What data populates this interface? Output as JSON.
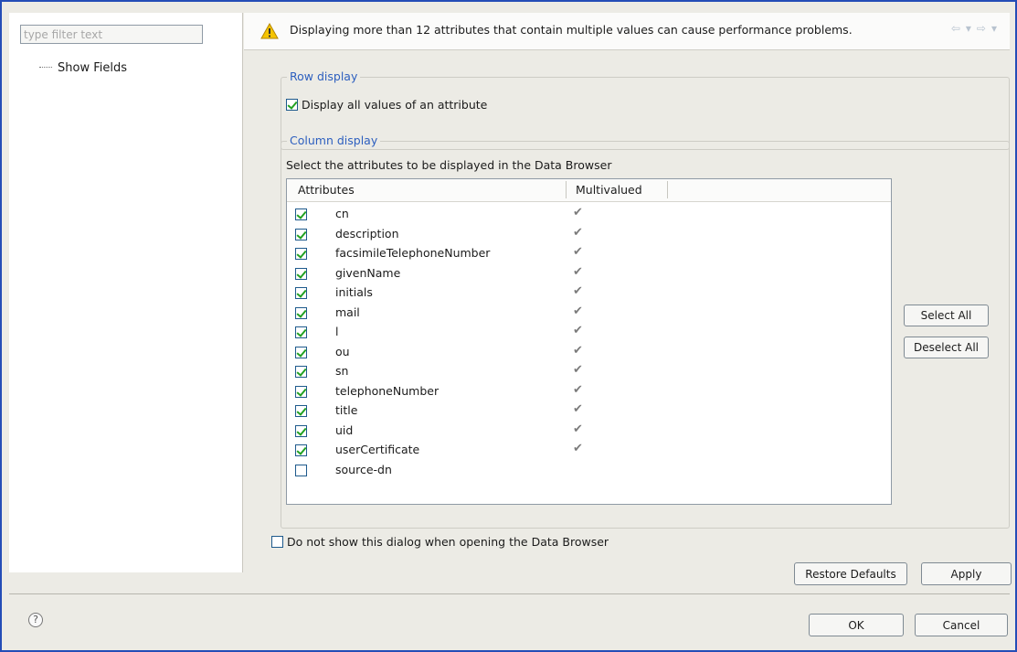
{
  "filter": {
    "placeholder": "type filter text"
  },
  "tree": {
    "items": [
      {
        "label": "Show Fields"
      }
    ]
  },
  "message": {
    "text": "Displaying more than 12 attributes that contain multiple values can cause performance problems.",
    "icon": "warning-icon"
  },
  "row_display": {
    "title": "Row display",
    "checkbox_label": "Display all values of an attribute",
    "checked": true
  },
  "column_display": {
    "title": "Column display",
    "description": "Select the attributes to be displayed in the Data Browser",
    "columns": [
      "Attributes",
      "Multivalued"
    ],
    "rows": [
      {
        "name": "cn",
        "checked": true,
        "multivalued": true
      },
      {
        "name": "description",
        "checked": true,
        "multivalued": true
      },
      {
        "name": "facsimileTelephoneNumber",
        "checked": true,
        "multivalued": true
      },
      {
        "name": "givenName",
        "checked": true,
        "multivalued": true
      },
      {
        "name": "initials",
        "checked": true,
        "multivalued": true
      },
      {
        "name": "mail",
        "checked": true,
        "multivalued": true
      },
      {
        "name": "l",
        "checked": true,
        "multivalued": true
      },
      {
        "name": "ou",
        "checked": true,
        "multivalued": true
      },
      {
        "name": "sn",
        "checked": true,
        "multivalued": true
      },
      {
        "name": "telephoneNumber",
        "checked": true,
        "multivalued": true
      },
      {
        "name": "title",
        "checked": true,
        "multivalued": true
      },
      {
        "name": "uid",
        "checked": true,
        "multivalued": true
      },
      {
        "name": "userCertificate",
        "checked": true,
        "multivalued": true
      },
      {
        "name": "source-dn",
        "checked": false,
        "multivalued": false
      }
    ],
    "select_all_label": "Select All",
    "deselect_all_label": "Deselect All"
  },
  "dont_show": {
    "label": "Do not show this dialog when opening the Data Browser",
    "checked": false
  },
  "buttons": {
    "restore_defaults": "Restore Defaults",
    "apply": "Apply",
    "ok": "OK",
    "cancel": "Cancel"
  },
  "help": {
    "glyph": "?"
  },
  "colors": {
    "accent": "#2d5fbf",
    "window_border": "#244db7",
    "check": "#21a121"
  }
}
